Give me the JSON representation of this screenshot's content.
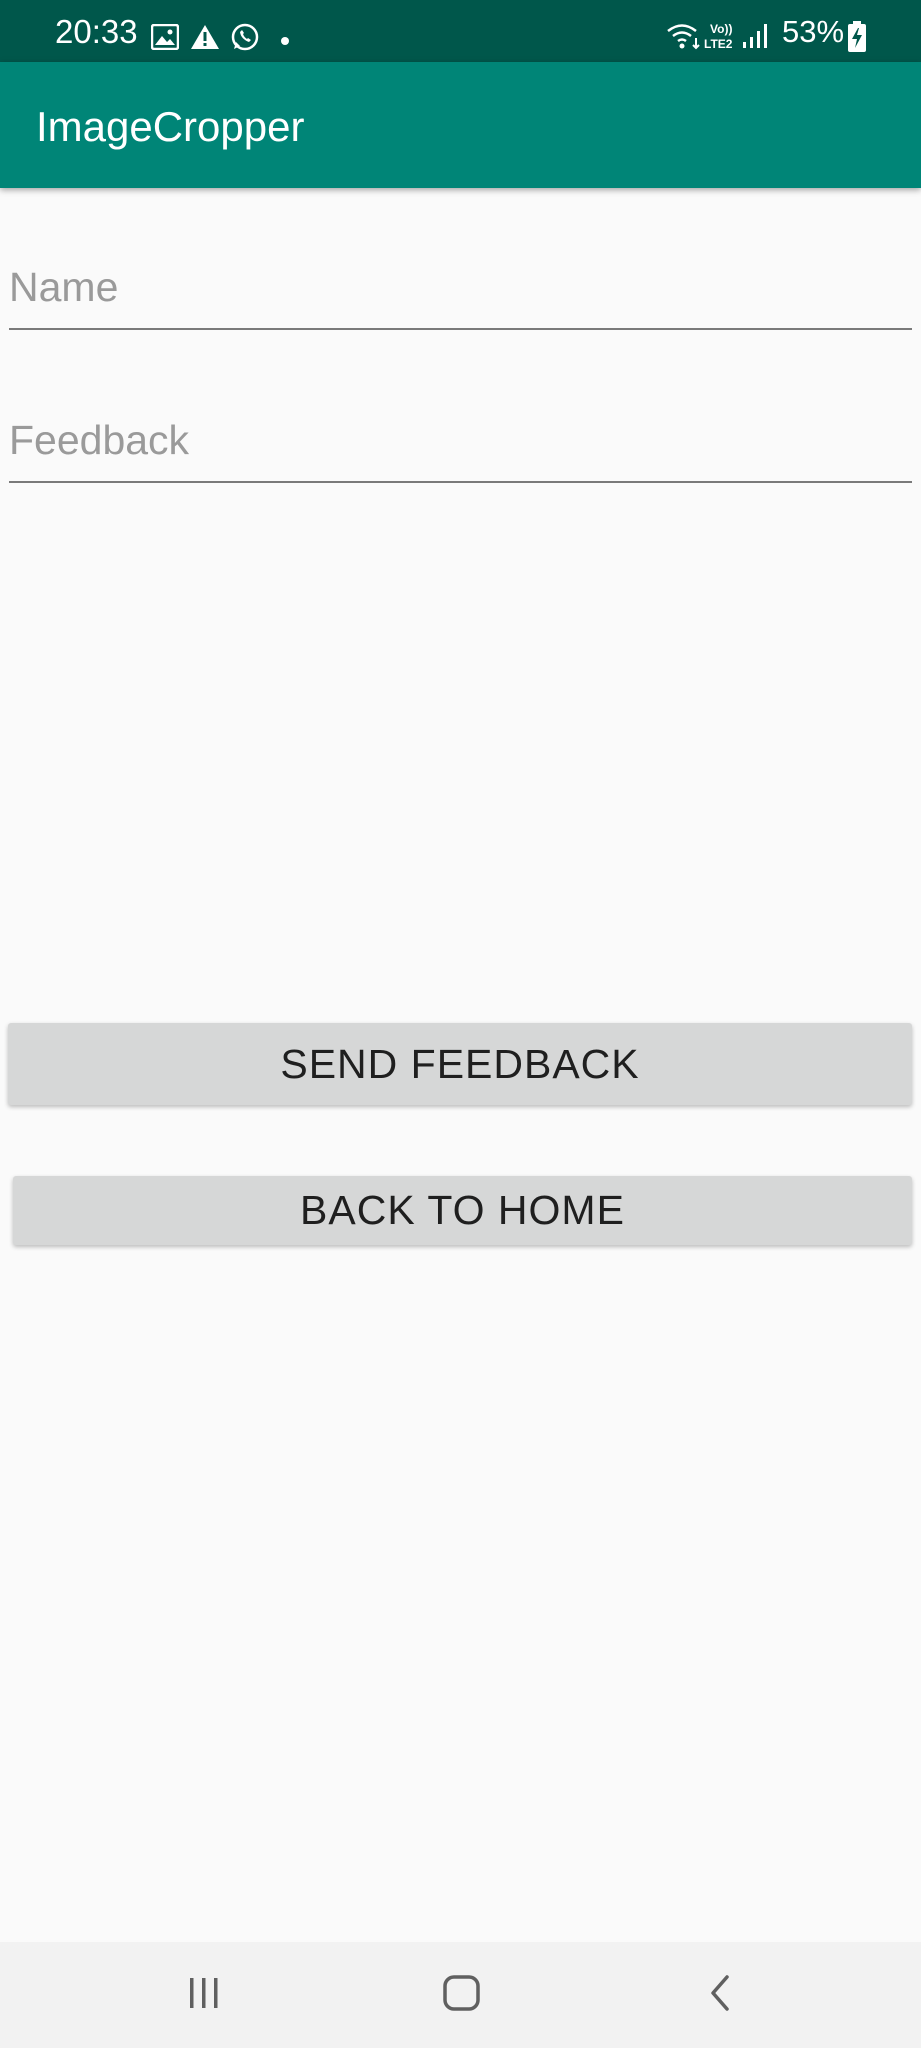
{
  "status_bar": {
    "time": "20:33",
    "battery": "53%",
    "icons_left": [
      "image-icon",
      "warning-icon",
      "whatsapp-icon",
      "dot-icon"
    ],
    "icons_right": [
      "wifi-icon",
      "volte-icon",
      "signal-icon",
      "battery-icon"
    ]
  },
  "app_bar": {
    "title": "ImageCropper"
  },
  "form": {
    "name_placeholder": "Name",
    "feedback_placeholder": "Feedback",
    "send_button": "SEND FEEDBACK",
    "home_button": "BACK TO HOME"
  },
  "nav_bar": {
    "icons": [
      "recents-icon",
      "home-icon",
      "back-icon"
    ]
  },
  "colors": {
    "status_bar": "#00574b",
    "app_bar": "#008577",
    "background": "#fafafa",
    "button": "#d6d7d7"
  }
}
